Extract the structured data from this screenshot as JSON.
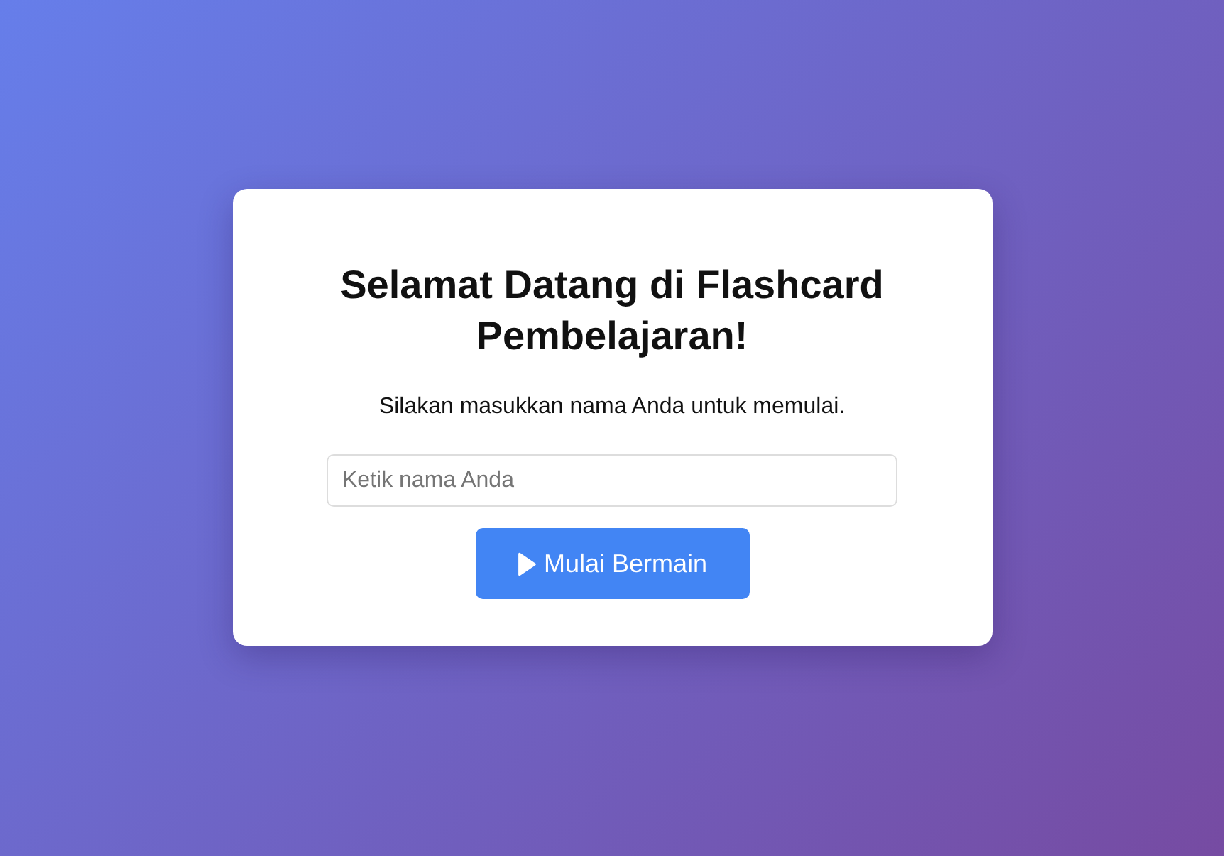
{
  "welcome_card": {
    "heading": "Selamat Datang di Flashcard Pembelajaran!",
    "subtitle": "Silakan masukkan nama Anda untuk memulai.",
    "name_field": {
      "placeholder": "Ketik nama Anda"
    },
    "start_button": {
      "label": "Mulai Bermain"
    }
  }
}
